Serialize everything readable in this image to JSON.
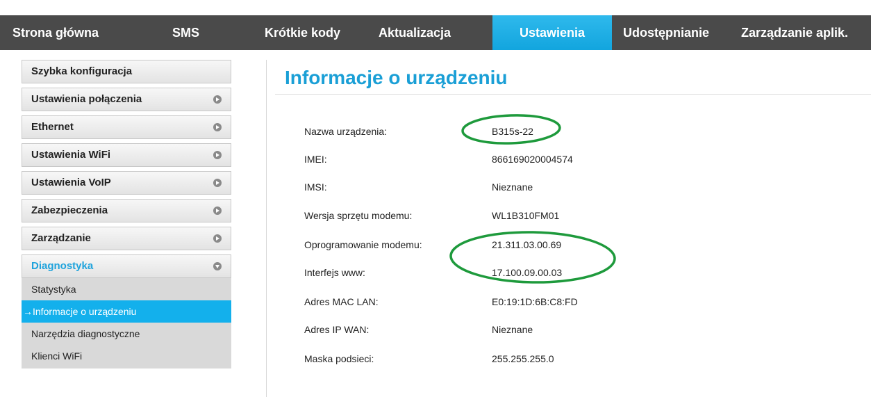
{
  "nav": {
    "tabs": [
      {
        "label": "Strona główna"
      },
      {
        "label": "SMS"
      },
      {
        "label": "Krótkie kody"
      },
      {
        "label": "Aktualizacja"
      },
      {
        "label": "Ustawienia"
      },
      {
        "label": "Udostępnianie"
      },
      {
        "label": "Zarządzanie aplik."
      }
    ],
    "active": "Ustawienia",
    "accent_color": "#1aa8e0"
  },
  "sidebar": {
    "items": [
      {
        "label": "Szybka konfiguracja"
      },
      {
        "label": "Ustawienia połączenia"
      },
      {
        "label": "Ethernet"
      },
      {
        "label": "Ustawienia WiFi"
      },
      {
        "label": "Ustawienia VoIP"
      },
      {
        "label": "Zabezpieczenia"
      },
      {
        "label": "Zarządzanie"
      },
      {
        "label": "Diagnostyka"
      }
    ],
    "submenu": [
      {
        "label": "Statystyka"
      },
      {
        "label": "→Informacje o urządzeniu"
      },
      {
        "label": "Narzędzia diagnostyczne"
      },
      {
        "label": "Klienci WiFi"
      }
    ]
  },
  "main": {
    "title": "Informacje o urządzeniu",
    "rows": [
      {
        "label": "Nazwa urządzenia:",
        "value": "B315s-22"
      },
      {
        "label": "IMEI:",
        "value": "866169020004574"
      },
      {
        "label": "IMSI:",
        "value": "Nieznane"
      },
      {
        "label": "Wersja sprzętu modemu:",
        "value": "WL1B310FM01"
      },
      {
        "label": "Oprogramowanie modemu:",
        "value": "21.311.03.00.69"
      },
      {
        "label": "Interfejs www:",
        "value": "17.100.09.00.03"
      },
      {
        "label": "Adres MAC LAN:",
        "value": "E0:19:1D:6B:C8:FD"
      },
      {
        "label": "Adres IP WAN:",
        "value": "Nieznane"
      },
      {
        "label": "Maska podsieci:",
        "value": "255.255.255.0"
      }
    ]
  },
  "annotation_color": "#1e9a3c"
}
